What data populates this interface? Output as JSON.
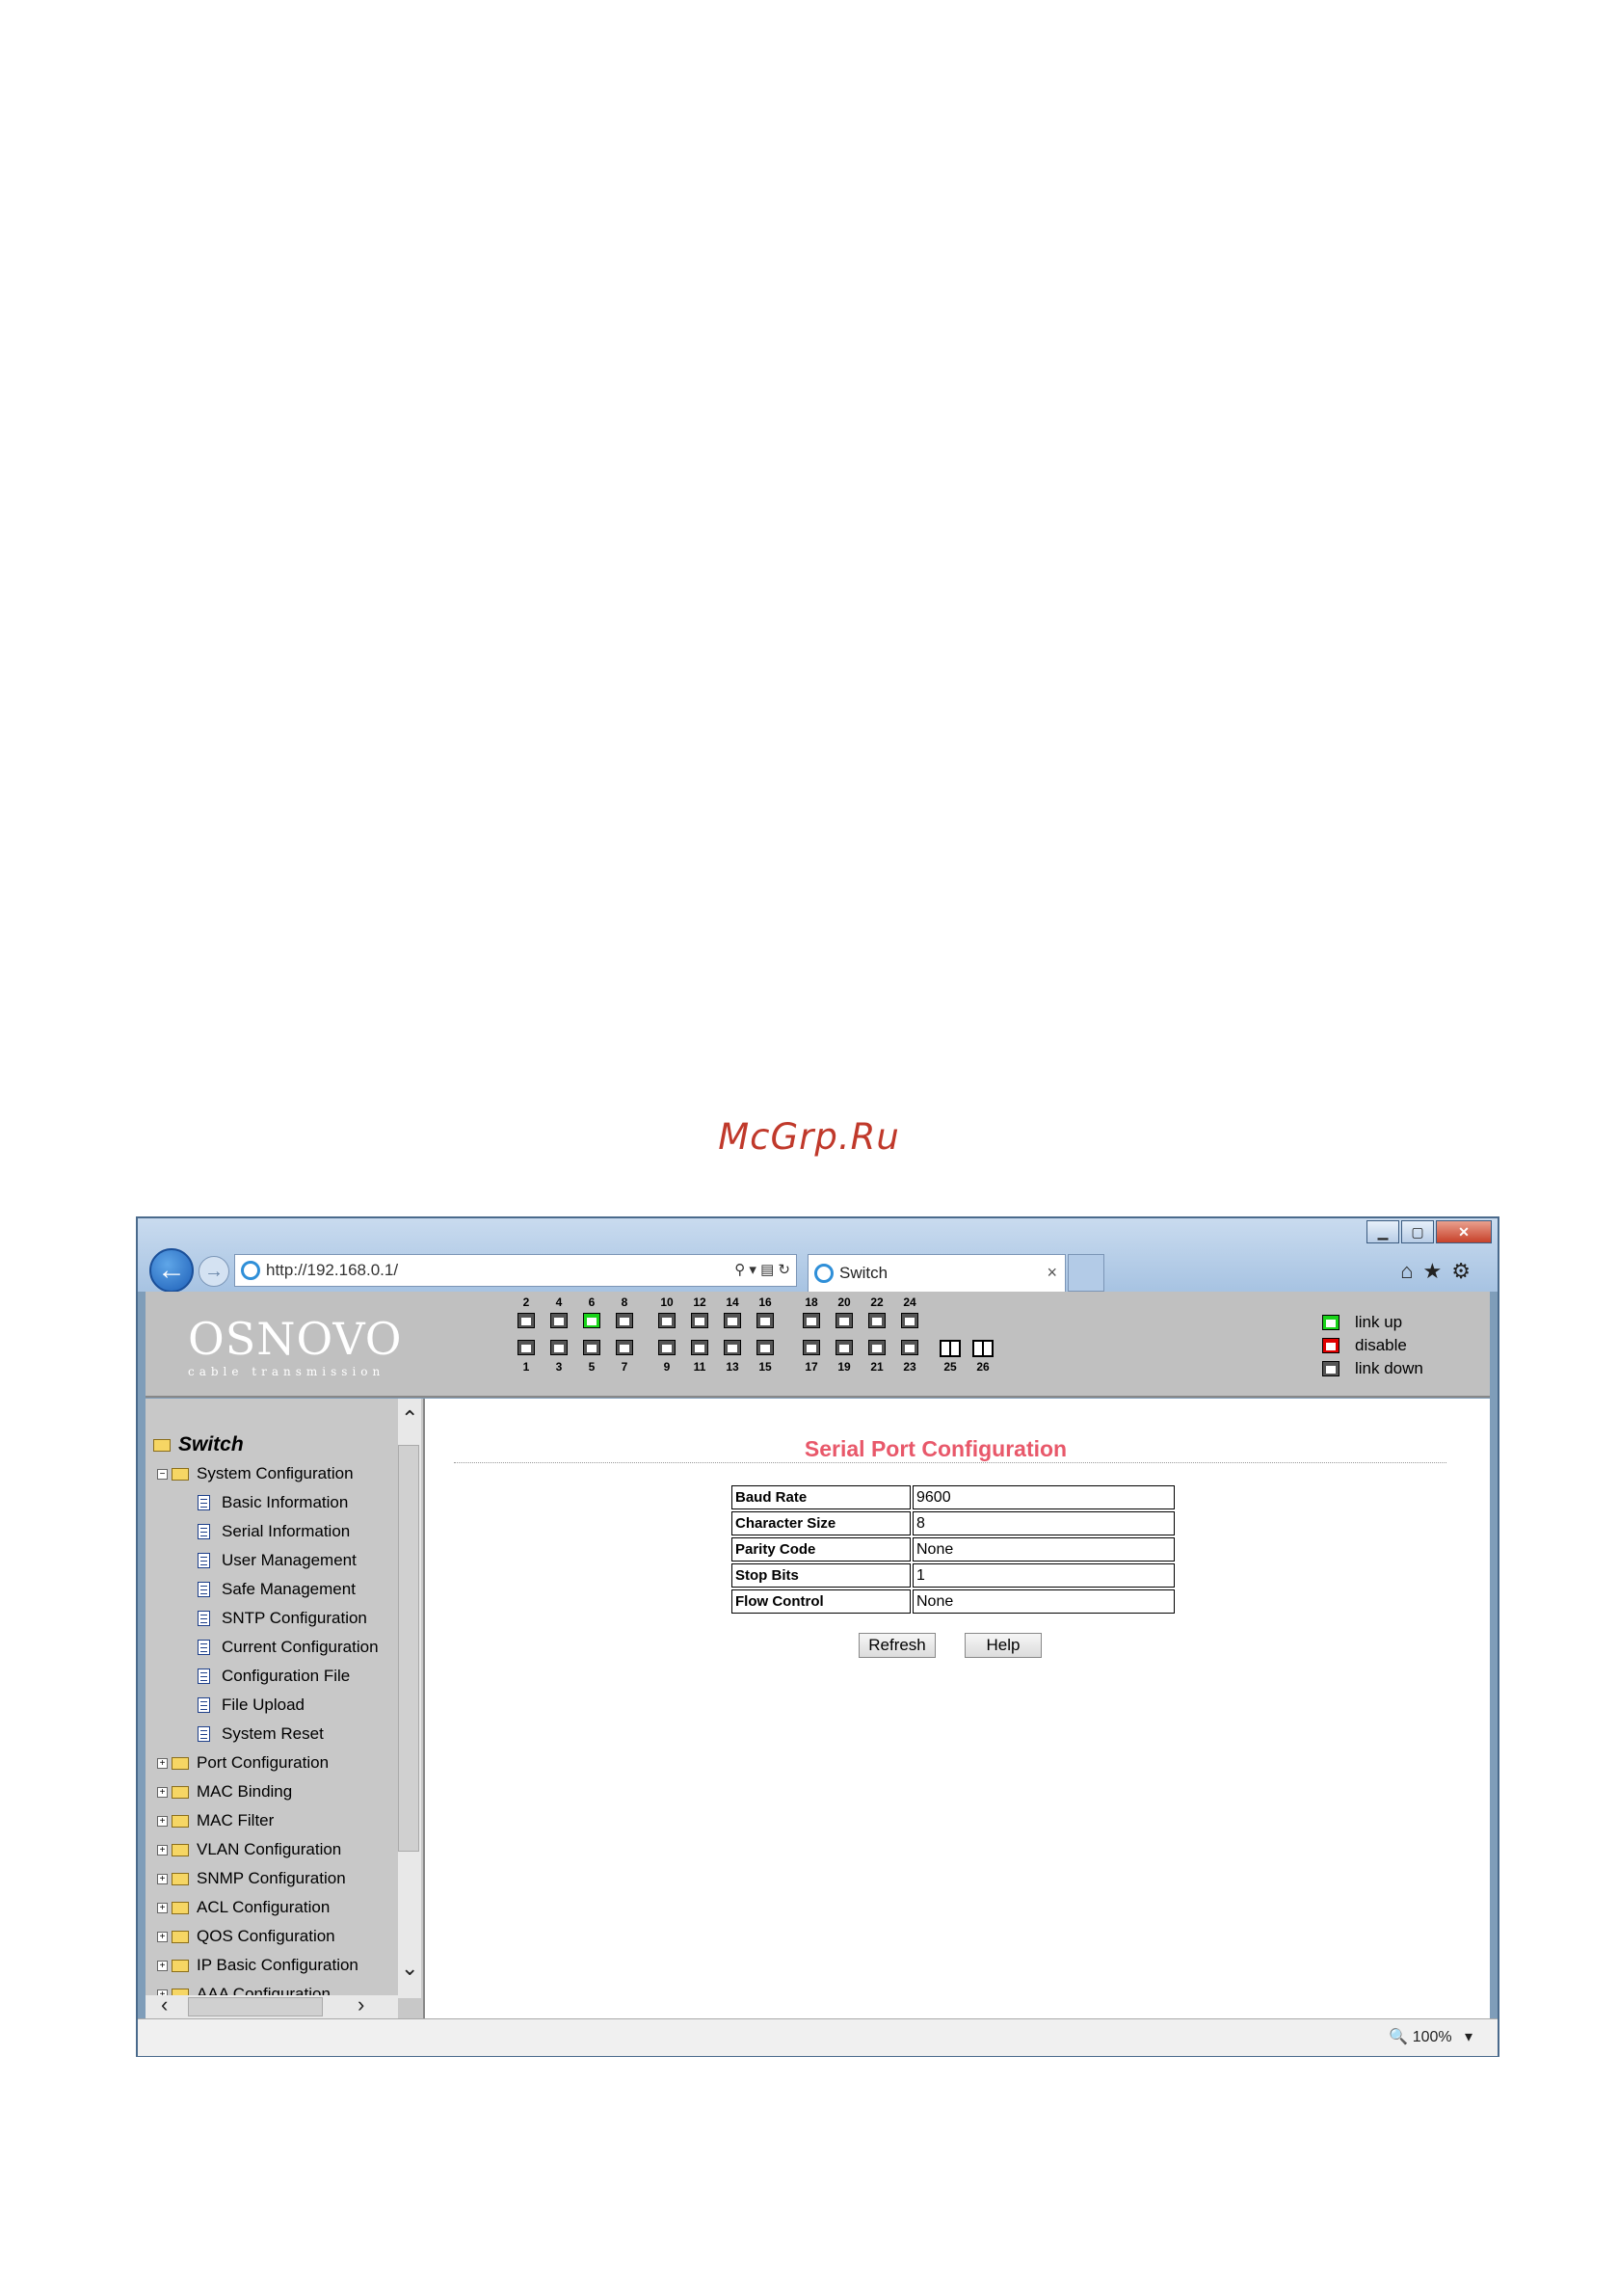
{
  "watermark": "McGrp.Ru",
  "browser": {
    "url": "http://192.168.0.1/",
    "tab_title": "Switch",
    "zoom": "100%",
    "window_buttons": {
      "minimize": "▁",
      "maximize": "▢",
      "close": "✕"
    }
  },
  "header": {
    "logo": "OSNOVO",
    "logo_sub": "cable transmission",
    "ports_top": [
      "2",
      "4",
      "6",
      "8",
      "10",
      "12",
      "14",
      "16",
      "18",
      "20",
      "22",
      "24"
    ],
    "ports_bottom": [
      "1",
      "3",
      "5",
      "7",
      "9",
      "11",
      "13",
      "15",
      "17",
      "19",
      "21",
      "23"
    ],
    "sfp_ports": [
      "25",
      "26"
    ],
    "link_up_ports": [
      "6"
    ],
    "legend": {
      "link_up": "link up",
      "disable": "disable",
      "link_down": "link down"
    },
    "colors": {
      "link_up": "#19d319",
      "disable": "#e00000",
      "link_down": "#555555"
    }
  },
  "sidebar": {
    "root": "Switch",
    "system_configuration": "System Configuration",
    "system_children": [
      "Basic Information",
      "Serial Information",
      "User Management",
      "Safe Management",
      "SNTP Configuration",
      "Current Configuration",
      "Configuration File",
      "File Upload",
      "System Reset"
    ],
    "groups": [
      "Port Configuration",
      "MAC Binding",
      "MAC Filter",
      "VLAN Configuration",
      "SNMP Configuration",
      "ACL Configuration",
      "QOS Configuration",
      "IP Basic Configuration",
      "AAA Configuration"
    ]
  },
  "main": {
    "title": "Serial Port Configuration",
    "title_color": "#e8586a",
    "rows": [
      {
        "label": "Baud Rate",
        "value": "9600"
      },
      {
        "label": "Character Size",
        "value": "8"
      },
      {
        "label": "Parity Code",
        "value": "None"
      },
      {
        "label": "Stop Bits",
        "value": "1"
      },
      {
        "label": "Flow Control",
        "value": "None"
      }
    ],
    "refresh_label": "Refresh",
    "help_label": "Help"
  }
}
